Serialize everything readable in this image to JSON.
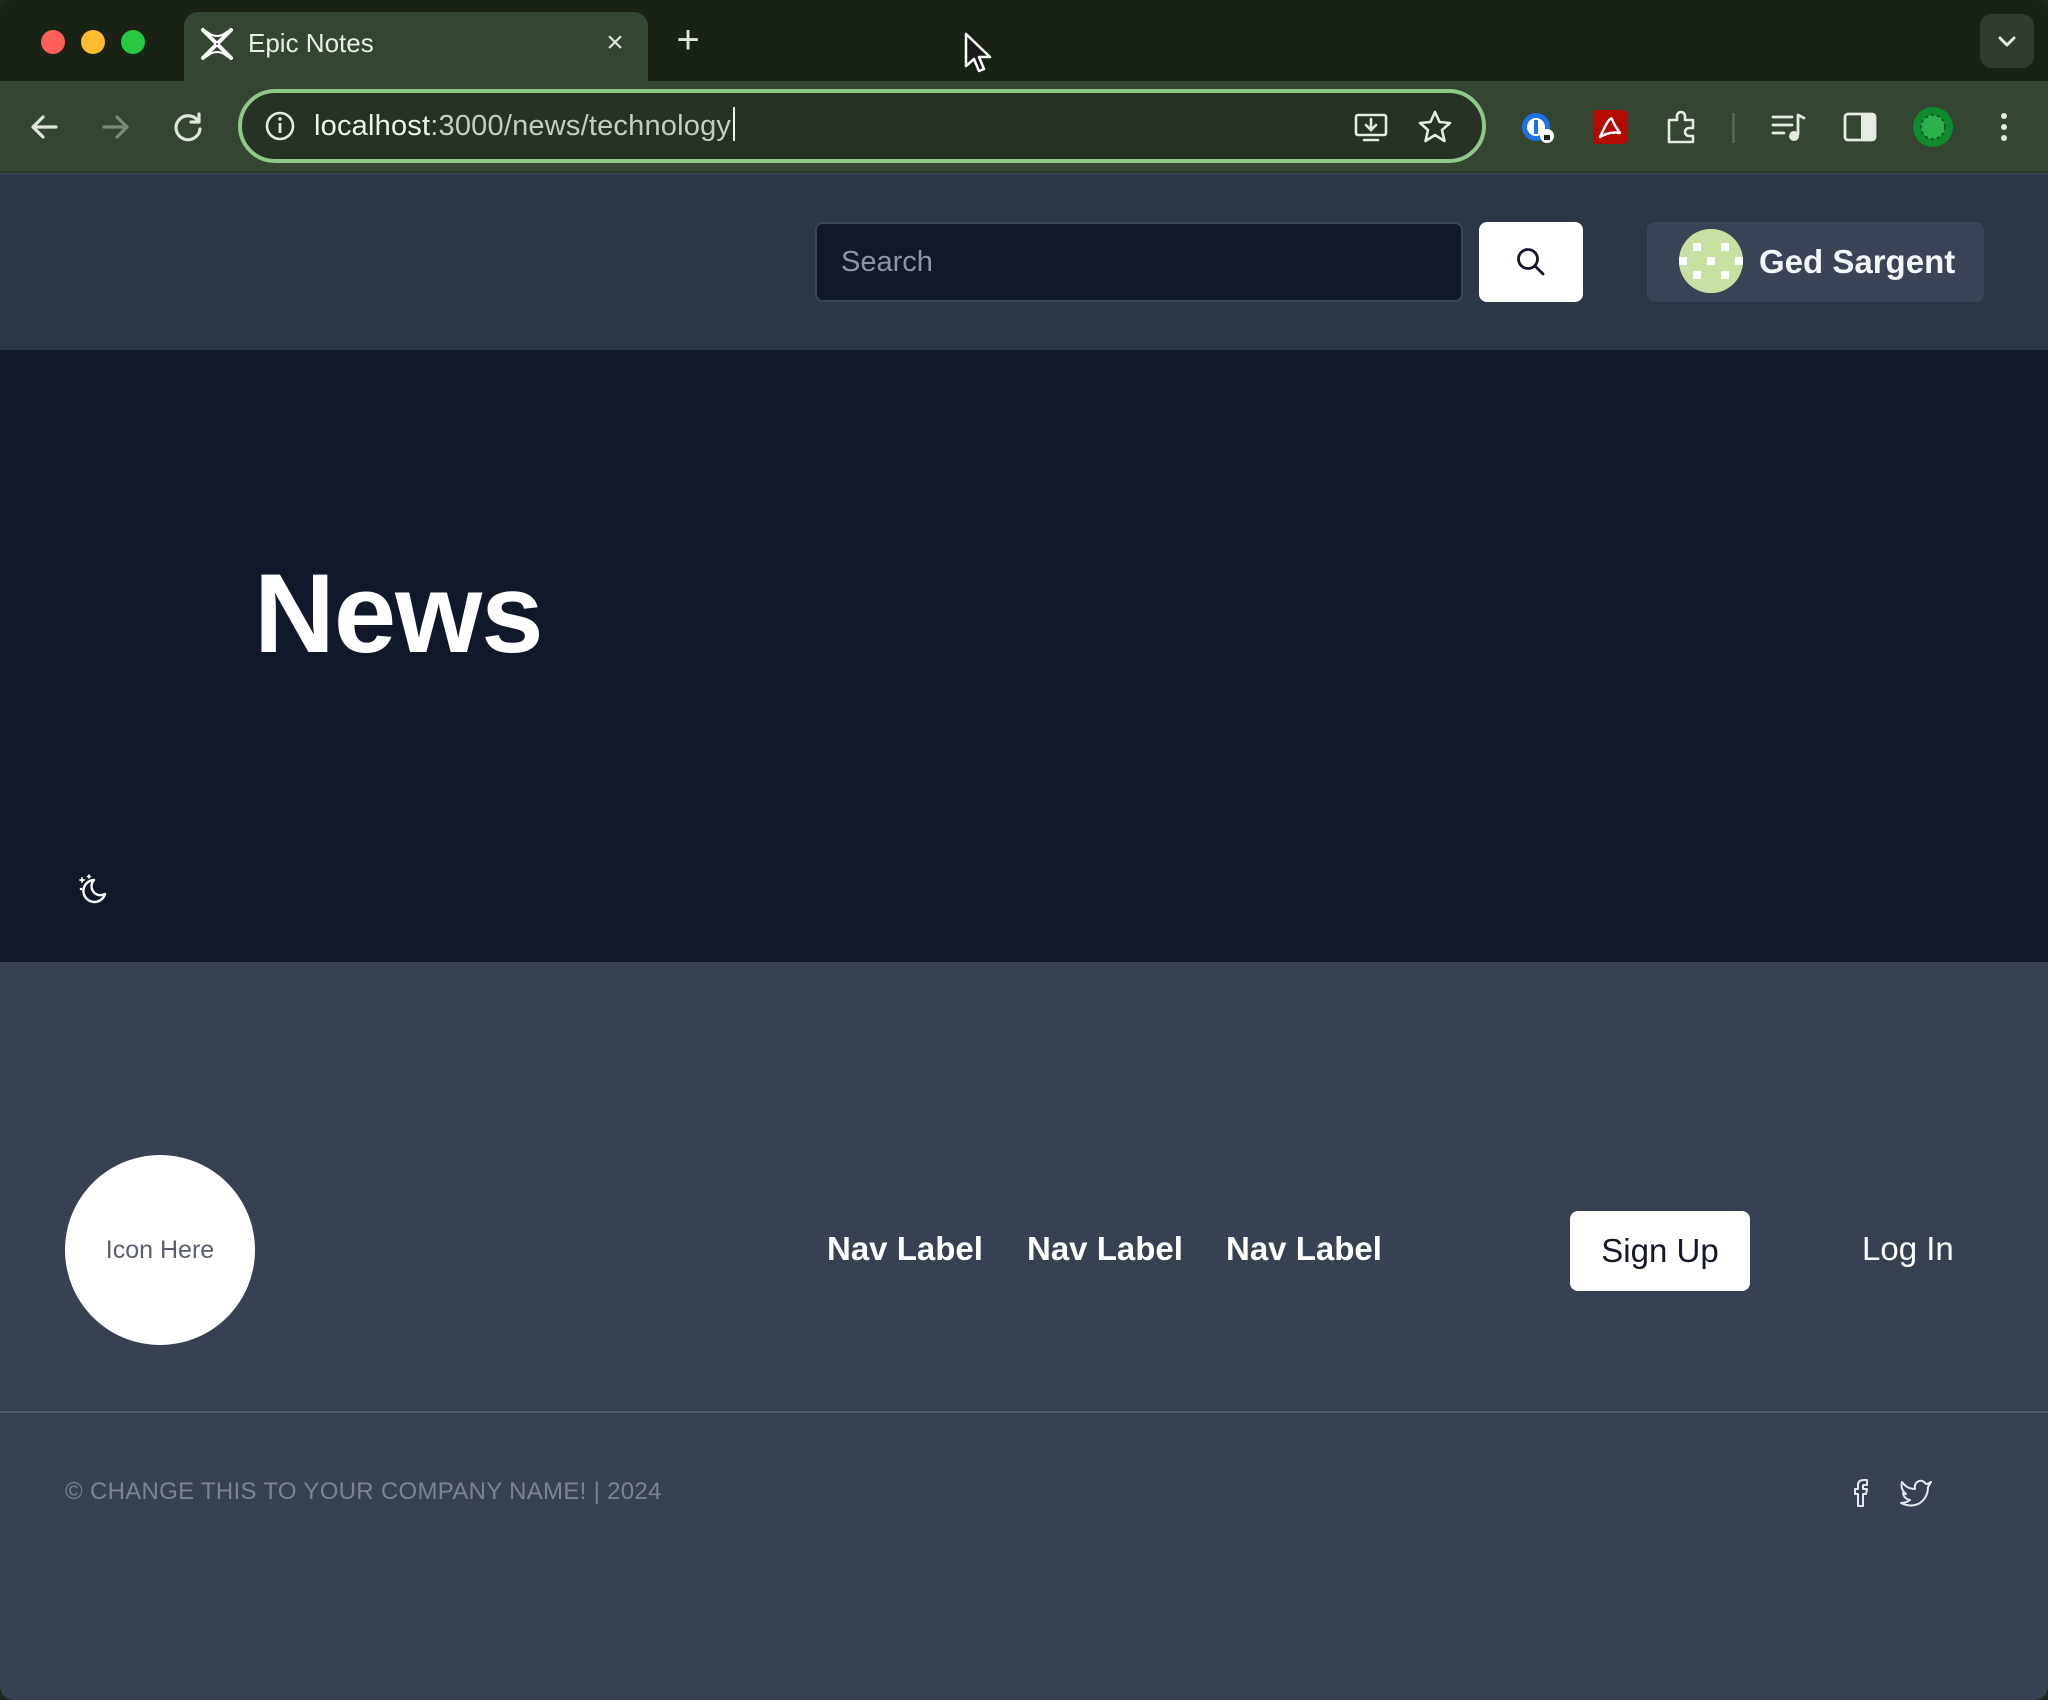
{
  "browser": {
    "tab_title": "Epic Notes",
    "tab_close": "×",
    "new_tab": "+",
    "url_host": "localhost",
    "url_path": ":3000/news/technology",
    "accent": "#8fc888"
  },
  "header": {
    "search": {
      "placeholder": "Search",
      "value": ""
    },
    "user": {
      "name": "Ged Sargent"
    }
  },
  "main": {
    "title": "News"
  },
  "footer": {
    "logo_text": "Icon Here",
    "nav": [
      {
        "label": "Nav Label"
      },
      {
        "label": "Nav Label"
      },
      {
        "label": "Nav Label"
      }
    ],
    "signup_label": "Sign Up",
    "login_label": "Log In",
    "copyright": "© CHANGE THIS TO YOUR COMPANY NAME! | 2024",
    "social": [
      "facebook-icon",
      "twitter-icon"
    ]
  },
  "colors": {
    "header_bg": "#2b3646",
    "main_bg": "#111829",
    "footer_bg": "#384152"
  }
}
